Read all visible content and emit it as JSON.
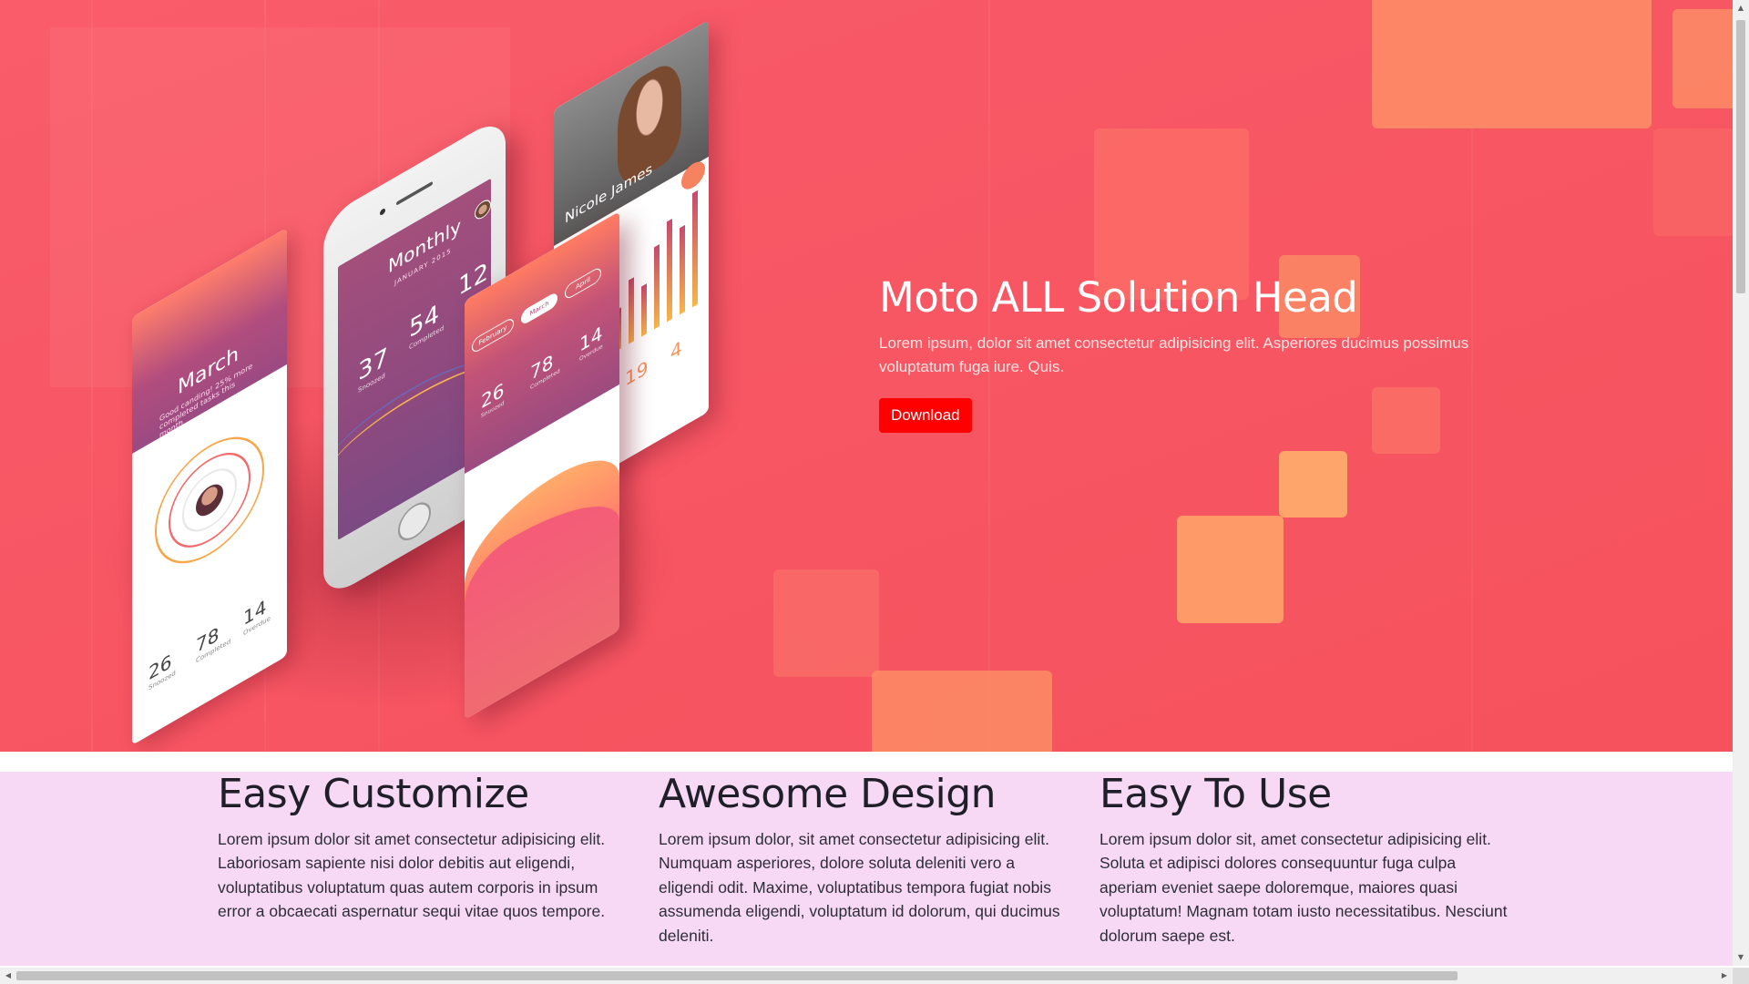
{
  "hero": {
    "title": "Moto ALL Solution Head",
    "description": "Lorem ipsum, dolor sit amet consectetur adipisicing elit. Asperiores ducimus possimus voluptatum fuga iure. Quis.",
    "download_label": "Download",
    "colors": {
      "background": "#f75663",
      "button": "#ff0000"
    }
  },
  "mockup": {
    "left_card": {
      "title": "March",
      "subtitle": "Good canding! 25% more completed tasks this month",
      "stats": [
        {
          "value": "26",
          "label": "Snoozed"
        },
        {
          "value": "78",
          "label": "Completed"
        },
        {
          "value": "14",
          "label": "Overdue"
        }
      ]
    },
    "phone": {
      "title": "Monthly",
      "subtitle": "JANUARY 2015",
      "stats": [
        {
          "value": "37",
          "label": "Snoozed"
        },
        {
          "value": "54",
          "label": "Completed"
        },
        {
          "value": "12",
          "label": ""
        }
      ]
    },
    "profile_card": {
      "name": "Nicole James",
      "stats": [
        "19",
        "4"
      ]
    },
    "overview_card": {
      "pills": [
        "February",
        "March",
        "April"
      ],
      "stats": [
        {
          "value": "26",
          "label": "Snoozed"
        },
        {
          "value": "78",
          "label": "Completed"
        },
        {
          "value": "14",
          "label": "Overdue"
        }
      ]
    }
  },
  "features": [
    {
      "title": "Easy Customize",
      "text": "Lorem ipsum dolor sit amet consectetur adipisicing elit. Laboriosam sapiente nisi dolor debitis aut eligendi, voluptatibus voluptatum quas autem corporis in ipsum error a obcaecati aspernatur sequi vitae quos tempore."
    },
    {
      "title": "Awesome Design",
      "text": "Lorem ipsum dolor, sit amet consectetur adipisicing elit. Numquam asperiores, dolore soluta deleniti vero a eligendi odit. Maxime, voluptatibus tempora fugiat nobis assumenda eligendi, voluptatum id dolorum, qui ducimus deleniti."
    },
    {
      "title": "Easy To Use",
      "text": "Lorem ipsum dolor sit, amet consectetur adipisicing elit. Soluta et adipisci dolores consequuntur fuga culpa aperiam eveniet saepe doloremque, maiores quasi voluptatum! Magnam totam iusto necessitatibus. Nesciunt dolorum saepe est."
    }
  ],
  "features_background": "#f8d9f5",
  "scrollbars": {
    "up_arrow": "▲",
    "down_arrow": "▼",
    "left_arrow": "◀",
    "right_arrow": "▶"
  }
}
